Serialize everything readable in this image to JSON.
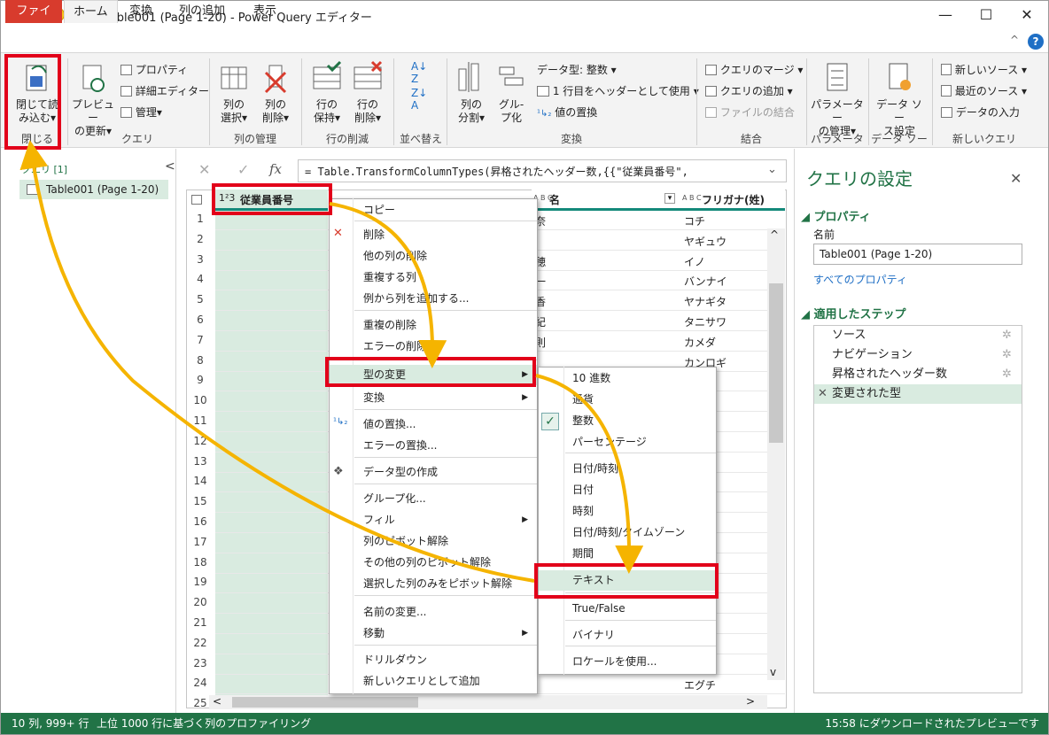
{
  "window": {
    "app_badge": "X",
    "quick_access": "☺▾ ▾",
    "title": "Table001 (Page 1-20) - Power Query エディター",
    "min": "—",
    "max": "☐",
    "close": "✕"
  },
  "tabs": [
    "ファイル",
    "ホーム",
    "変換",
    "列の追加",
    "表示"
  ],
  "ribbon": {
    "close_load": "閉じて読\nみ込む▾",
    "preview": "プレビュー\nの更新▾",
    "properties": "プロパティ",
    "advanced_editor": "詳細エディター",
    "manage": "管理▾",
    "choose_cols": "列の\n選択▾",
    "remove_cols": "列の\n削除▾",
    "keep_rows": "行の\n保持▾",
    "remove_rows": "行の\n削除▾",
    "split_col": "列の\n分割▾",
    "group_by": "グル-\nプ化",
    "data_type": "データ型: 整数 ▾",
    "first_row_header": "1 行目をヘッダーとして使用 ▾",
    "replace_values": "値の置換",
    "merge_queries": "クエリのマージ ▾",
    "append_queries": "クエリの追加 ▾",
    "combine_files": "ファイルの結合",
    "parameters": "パラメーター\nの管理▾",
    "data_source": "データ ソー\nス設定",
    "new_source": "新しいソース ▾",
    "recent_sources": "最近のソース ▾",
    "enter_data": "データの入力",
    "groups": [
      "閉じる",
      "クエリ",
      "列の管理",
      "行の削減",
      "並べ替え",
      "変換",
      "結合",
      "パラメーター",
      "データ ソース",
      "新しいクエリ"
    ],
    "help": "?",
    "collapse": "^"
  },
  "queries": {
    "header": "クエリ [1]",
    "item": "Table001 (Page 1-20)",
    "collapse": "<"
  },
  "formula": {
    "cancel": "✕",
    "ok": "✓",
    "fx": "fx",
    "text": "= Table.TransformColumnTypes(昇格されたヘッダー数,{{\"従業員番号\",",
    "expand": "⌄"
  },
  "grid": {
    "headers": [
      {
        "type": "1²3",
        "name": "従業員番号"
      },
      {
        "type": "A B C",
        "name": "名"
      },
      {
        "type": "A B C",
        "name": "フリガナ(姓)"
      }
    ],
    "rows": [
      "1",
      "2",
      "3",
      "4",
      "5",
      "6",
      "7",
      "8",
      "9",
      "10",
      "11",
      "12",
      "13",
      "14",
      "15",
      "16",
      "17",
      "18",
      "19",
      "20",
      "21",
      "22",
      "23",
      "24",
      "25"
    ],
    "col_name": [
      "奈",
      "",
      "穂",
      "一",
      "香",
      "紀",
      "則",
      "",
      "",
      "",
      "",
      "",
      "",
      "",
      "",
      "",
      "",
      "",
      "",
      "",
      "",
      "",
      "",
      "",
      ""
    ],
    "col_kana": [
      "コチ",
      "ヤギュウ",
      "イノ",
      "バンナイ",
      "ヤナギタ",
      "タニサワ",
      "カメダ",
      "カンロギ",
      "ワ",
      "",
      "",
      "",
      "ラ",
      "",
      "",
      "",
      "ワ",
      "",
      "",
      "",
      "",
      "テ",
      "",
      "エグチ",
      ""
    ]
  },
  "context_menu": [
    "コピー",
    "削除",
    "他の列の削除",
    "重複する列",
    "例から列を追加する...",
    "重複の削除",
    "エラーの削除",
    "型の変更",
    "変換",
    "値の置換...",
    "エラーの置換...",
    "データ型の作成",
    "グループ化...",
    "フィル",
    "列のピボット解除",
    "その他の列のピボット解除",
    "選択した列のみをピボット解除",
    "名前の変更...",
    "移動",
    "ドリルダウン",
    "新しいクエリとして追加"
  ],
  "submenu": [
    "10 進数",
    "通貨",
    "整数",
    "パーセンテージ",
    "日付/時刻",
    "日付",
    "時刻",
    "日付/時刻/タイムゾーン",
    "期間",
    "テキスト",
    "True/False",
    "バイナリ",
    "ロケールを使用..."
  ],
  "settings": {
    "title": "クエリの設定",
    "close": "✕",
    "properties": "プロパティ",
    "name_label": "名前",
    "name_value": "Table001 (Page 1-20)",
    "all_properties": "すべてのプロパティ",
    "applied_steps": "適用したステップ",
    "steps": [
      "ソース",
      "ナビゲーション",
      "昇格されたヘッダー数",
      "変更された型"
    ]
  },
  "status": {
    "left": "10 列, 999+ 行",
    "profile": "上位 1000 行に基づく列のプロファイリング",
    "right": "15:58 にダウンロードされたプレビューです"
  },
  "colors": {
    "accent": "#217346",
    "highlight": "#d9ebe0",
    "callout": "#e2001a",
    "arrow": "#f5b400"
  }
}
